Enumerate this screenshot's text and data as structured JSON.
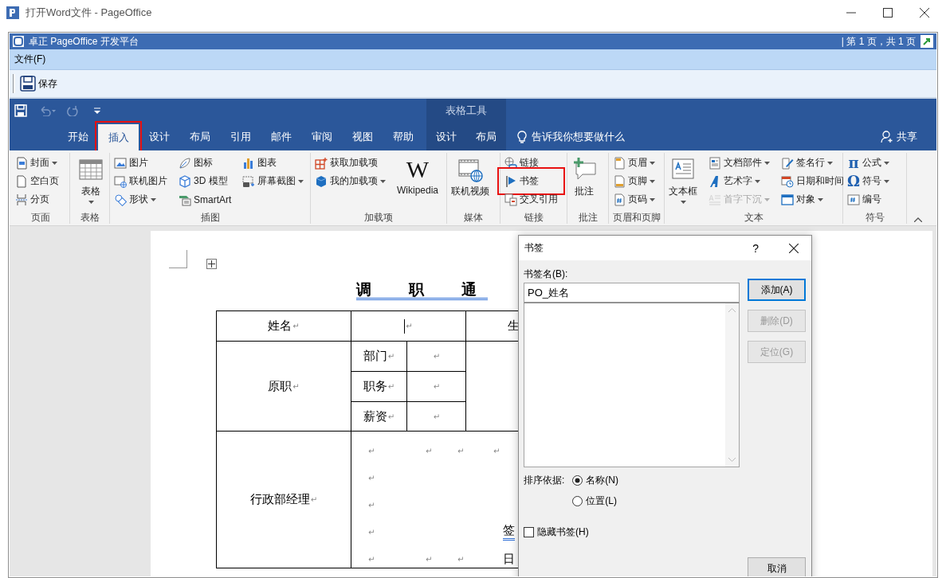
{
  "window": {
    "title": "打开Word文件 - PageOffice"
  },
  "pageoffice": {
    "title": "卓正 PageOffice 开发平台",
    "page_info": "| 第 1 页，共 1 页",
    "menu": [
      {
        "label": "文件(F)"
      }
    ],
    "toolbar": [
      {
        "label": "保存"
      }
    ]
  },
  "ribbon": {
    "context_label": "表格工具",
    "tabs": [
      {
        "label": "开始",
        "selected": false,
        "highlighted": false,
        "kind": "main"
      },
      {
        "label": "插入",
        "selected": true,
        "highlighted": true,
        "kind": "main"
      },
      {
        "label": "设计",
        "selected": false,
        "highlighted": false,
        "kind": "main"
      },
      {
        "label": "布局",
        "selected": false,
        "highlighted": false,
        "kind": "main"
      },
      {
        "label": "引用",
        "selected": false,
        "highlighted": false,
        "kind": "main"
      },
      {
        "label": "邮件",
        "selected": false,
        "highlighted": false,
        "kind": "main"
      },
      {
        "label": "审阅",
        "selected": false,
        "highlighted": false,
        "kind": "main"
      },
      {
        "label": "视图",
        "selected": false,
        "highlighted": false,
        "kind": "main"
      },
      {
        "label": "帮助",
        "selected": false,
        "highlighted": false,
        "kind": "main"
      },
      {
        "label": "设计",
        "selected": false,
        "highlighted": false,
        "kind": "context"
      },
      {
        "label": "布局",
        "selected": false,
        "highlighted": false,
        "kind": "context"
      }
    ],
    "tell_me": "告诉我你想要做什么",
    "share": "共享",
    "groups": [
      {
        "label": "页面",
        "items": [
          {
            "kind": "small",
            "label": "封面",
            "dropdown": true
          },
          {
            "kind": "small",
            "label": "空白页",
            "dropdown": false
          },
          {
            "kind": "small",
            "label": "分页",
            "dropdown": false
          }
        ]
      },
      {
        "label": "表格",
        "items": [
          {
            "kind": "large",
            "label": "表格",
            "dropdown": true
          }
        ]
      },
      {
        "label": "插图",
        "items": [
          {
            "kind": "small",
            "label": "图片",
            "dropdown": false
          },
          {
            "kind": "small",
            "label": "联机图片",
            "dropdown": false
          },
          {
            "kind": "small",
            "label": "形状",
            "dropdown": true
          },
          {
            "kind": "small",
            "label": "图标",
            "dropdown": false
          },
          {
            "kind": "small",
            "label": "3D 模型",
            "dropdown": false
          },
          {
            "kind": "small",
            "label": "SmartArt",
            "dropdown": false
          },
          {
            "kind": "small",
            "label": "图表",
            "dropdown": false
          },
          {
            "kind": "small",
            "label": "屏幕截图",
            "dropdown": true
          }
        ]
      },
      {
        "label": "加载项",
        "items": [
          {
            "kind": "small",
            "label": "获取加载项",
            "dropdown": false
          },
          {
            "kind": "small",
            "label": "我的加载项",
            "dropdown": true
          },
          {
            "kind": "large",
            "label": "Wikipedia",
            "glyph": "W",
            "dropdown": false
          }
        ]
      },
      {
        "label": "媒体",
        "items": [
          {
            "kind": "large",
            "label": "联机视频",
            "dropdown": false
          }
        ]
      },
      {
        "label": "链接",
        "items": [
          {
            "kind": "small",
            "label": "链接",
            "dropdown": false
          },
          {
            "kind": "small",
            "label": "书签",
            "dropdown": false,
            "highlighted": true
          },
          {
            "kind": "small",
            "label": "交叉引用",
            "dropdown": false
          }
        ]
      },
      {
        "label": "批注",
        "items": [
          {
            "kind": "large",
            "label": "批注",
            "dropdown": false
          }
        ]
      },
      {
        "label": "页眉和页脚",
        "items": [
          {
            "kind": "small",
            "label": "页眉",
            "dropdown": true
          },
          {
            "kind": "small",
            "label": "页脚",
            "dropdown": true
          },
          {
            "kind": "small",
            "label": "页码",
            "dropdown": true
          }
        ]
      },
      {
        "label": "文本",
        "items": [
          {
            "kind": "large",
            "label": "文本框",
            "dropdown": true
          },
          {
            "kind": "small",
            "label": "文档部件",
            "dropdown": true
          },
          {
            "kind": "small",
            "label": "艺术字",
            "dropdown": true
          },
          {
            "kind": "small",
            "label": "首字下沉",
            "dropdown": true,
            "disabled": true
          },
          {
            "kind": "small",
            "label": "签名行",
            "dropdown": true
          },
          {
            "kind": "small",
            "label": "日期和时间",
            "dropdown": false
          },
          {
            "kind": "small",
            "label": "对象",
            "dropdown": true
          }
        ]
      },
      {
        "label": "符号",
        "items": [
          {
            "kind": "small",
            "label": "公式",
            "glyph": "π",
            "dropdown": true
          },
          {
            "kind": "small",
            "label": "符号",
            "glyph": "Ω",
            "dropdown": true
          },
          {
            "kind": "small",
            "label": "编号",
            "dropdown": false
          }
        ]
      }
    ]
  },
  "document": {
    "title": "调　职　通",
    "cells": [
      {
        "text": "姓名",
        "mark": "↵"
      },
      {
        "mark": "↵",
        "cursor": true
      },
      {
        "text": "生"
      },
      {
        "text": "原职",
        "mark": "↵"
      },
      {
        "text": "部门",
        "mark": "↵"
      },
      {
        "mark": "↵"
      },
      {
        "text": "职务",
        "mark": "↵"
      },
      {
        "mark": "↵"
      },
      {
        "text": "薪资",
        "mark": "↵"
      },
      {
        "mark": "↵"
      },
      {
        "text": "行政部经理",
        "mark": "↵"
      },
      {
        "lines": [
          [
            {
              "kind": "mark",
              "text": "↵"
            },
            {
              "kind": "mark",
              "text": "↵"
            },
            {
              "kind": "mark",
              "text": "↵"
            },
            {
              "kind": "mark",
              "text": "↵"
            }
          ],
          [
            {
              "kind": "mark",
              "text": "↵"
            }
          ],
          [
            {
              "kind": "mark",
              "text": "↵"
            }
          ],
          [
            {
              "kind": "mark",
              "text": "↵"
            },
            {
              "kind": "word",
              "text": "签",
              "underlined": true
            }
          ],
          [
            {
              "kind": "mark",
              "text": "↵"
            },
            {
              "kind": "mark",
              "text": "↵"
            },
            {
              "kind": "mark",
              "text": "↵"
            },
            {
              "kind": "word",
              "text": "日",
              "underlined": false
            }
          ]
        ]
      }
    ]
  },
  "dialog": {
    "title": "书签",
    "help": "?",
    "name_label": "书签名(B):",
    "name_value": "PO_姓名",
    "sort_label": "排序依据:",
    "sort_options": [
      {
        "label": "名称(N)",
        "selected": true
      },
      {
        "label": "位置(L)",
        "selected": false
      }
    ],
    "hide": {
      "label": "隐藏书签(H)",
      "checked": false
    },
    "buttons": [
      {
        "label": "添加(A)",
        "default": true,
        "disabled": false
      },
      {
        "label": "删除(D)",
        "default": false,
        "disabled": true
      },
      {
        "label": "定位(G)",
        "default": false,
        "disabled": true
      },
      {
        "label": "取消",
        "default": false,
        "disabled": false
      }
    ]
  }
}
